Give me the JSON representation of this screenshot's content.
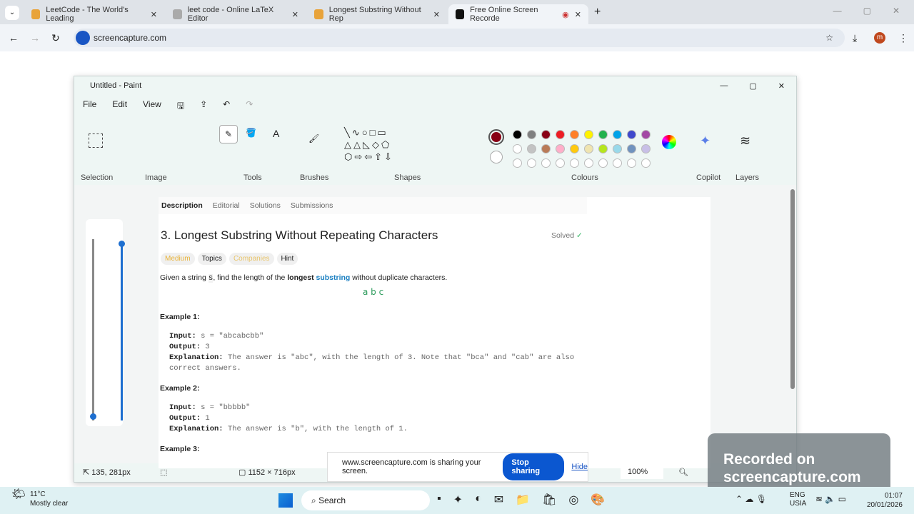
{
  "browser": {
    "tabs": [
      {
        "label": "LeetCode - The World's Leading"
      },
      {
        "label": "leet code - Online LaTeX Editor"
      },
      {
        "label": "Longest Substring Without Rep"
      },
      {
        "label": "Free Online Screen Recorde",
        "active": true
      }
    ],
    "url": "screencapture.com",
    "profile_initial": "m"
  },
  "paint": {
    "title": "Untitled - Paint",
    "menu": [
      "File",
      "Edit",
      "View"
    ],
    "groups": [
      "Selection",
      "Image",
      "Tools",
      "Brushes",
      "Shapes",
      "Colours",
      "Copilot",
      "Layers"
    ],
    "colours_row1": [
      "#000000",
      "#7f7f7f",
      "#880015",
      "#ed1c24",
      "#ff7f27",
      "#fff200",
      "#22b14c",
      "#00a2e8",
      "#3f48cc",
      "#a349a4"
    ],
    "colours_row2": [
      "#ffffff",
      "#c3c3c3",
      "#b97a57",
      "#ffaec9",
      "#ffc90e",
      "#efe4b0",
      "#b5e61d",
      "#99d9ea",
      "#7092be",
      "#c8bfe7"
    ],
    "primary_colour": "#880015",
    "status": {
      "cursor": "135, 281px",
      "canvas_size": "1152 × 716px",
      "zoom": "100%"
    }
  },
  "leetcode": {
    "tabs": [
      "Description",
      "Editorial",
      "Solutions",
      "Submissions"
    ],
    "title": "3. Longest Substring Without Repeating Characters",
    "solved": "Solved",
    "tags": [
      "Medium",
      "Topics",
      "Companies",
      "Hint"
    ],
    "desc_pre": "Given a string",
    "desc_s": "s",
    "desc_mid": ", find the length of the",
    "desc_bold": "longest",
    "desc_link": "substring",
    "desc_post": "without duplicate characters.",
    "handwriting": "a b c",
    "examples": [
      {
        "h": "Example 1:",
        "input": "s = \"abcabcbb\"",
        "output": "3",
        "expl": "The answer is \"abc\", with the length of 3. Note that \"bca\" and \"cab\" are also correct answers."
      },
      {
        "h": "Example 2:",
        "input": "s = \"bbbbb\"",
        "output": "1",
        "expl": "The answer is \"b\", with the length of 1."
      },
      {
        "h": "Example 3:"
      }
    ],
    "labels": {
      "input": "Input:",
      "output": "Output:",
      "expl": "Explanation:"
    }
  },
  "share": {
    "text": "www.screencapture.com is sharing your screen.",
    "stop": "Stop sharing",
    "hide": "Hide"
  },
  "watermark": "Recorded on screencapture.com",
  "taskbar": {
    "weather_temp": "11°C",
    "weather_desc": "Mostly clear",
    "search": "Search",
    "lang1": "ENG",
    "lang2": "USIA",
    "time": "01:07",
    "date": "20/01/2026"
  }
}
